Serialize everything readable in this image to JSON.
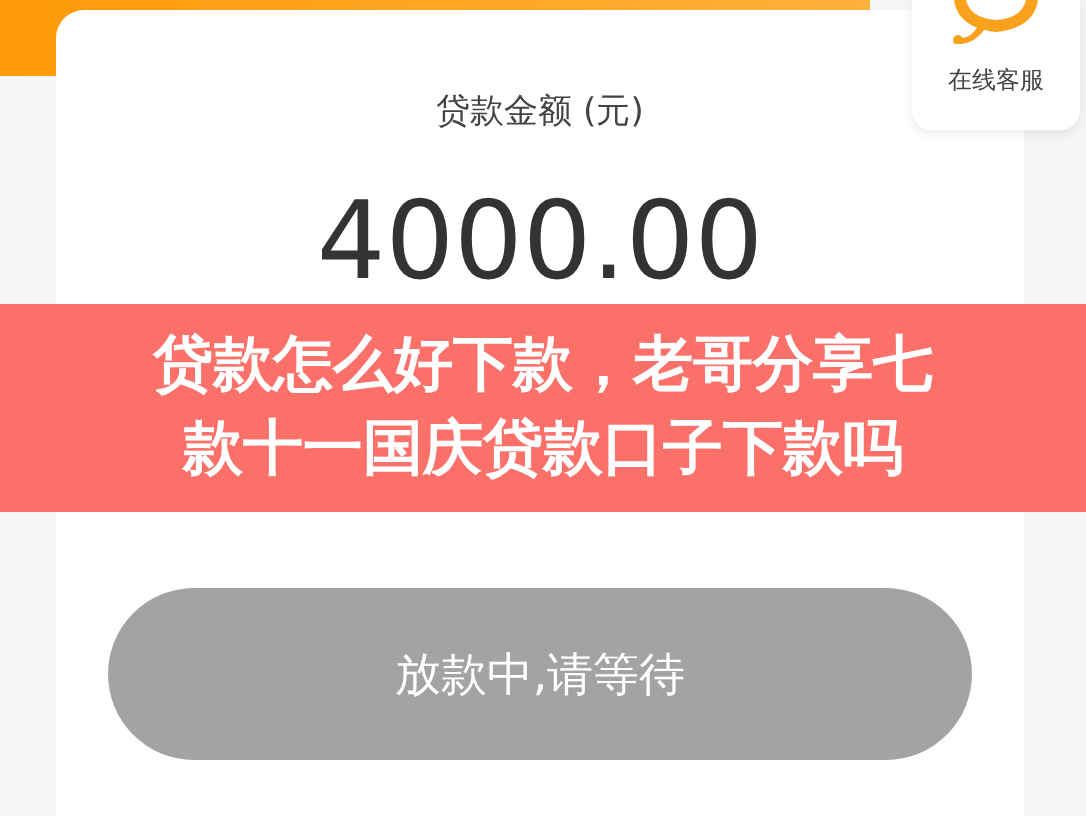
{
  "loan_card": {
    "label": "贷款金额 (元)",
    "amount": "4000.00"
  },
  "customer_service": {
    "label": "在线客服"
  },
  "title_banner": {
    "lines": [
      "贷款怎么好下款，老哥分享七",
      "款十一国庆贷款口子下款吗"
    ]
  },
  "status_button": {
    "label": "放款中,请等待",
    "disabled": true
  }
}
